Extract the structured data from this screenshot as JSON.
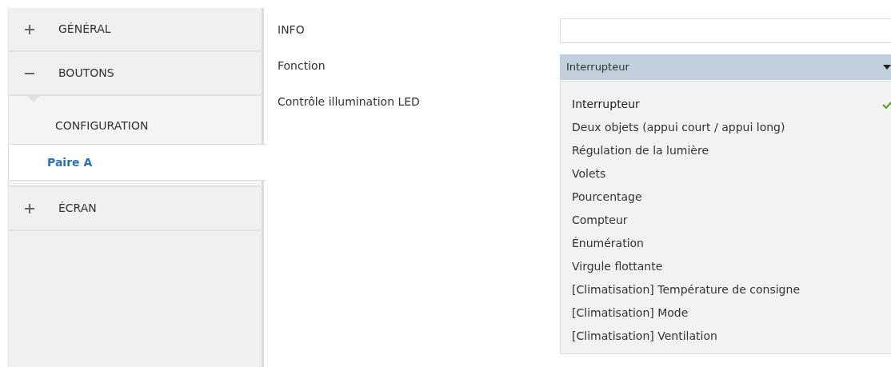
{
  "sidebar": {
    "items": [
      {
        "label": "GÉNÉRAL",
        "expanded": false
      },
      {
        "label": "BOUTONS",
        "expanded": true,
        "children": [
          {
            "label": "CONFIGURATION",
            "selected": false
          },
          {
            "label": "Paire A",
            "selected": true
          }
        ]
      },
      {
        "label": "ÉCRAN",
        "expanded": false
      }
    ]
  },
  "form": {
    "fields": [
      {
        "label": "INFO",
        "kind": "text"
      },
      {
        "label": "Fonction",
        "kind": "dropdown",
        "value": "Interrupteur",
        "expanded": true,
        "options": [
          {
            "label": "Interrupteur",
            "selected": true
          },
          {
            "label": "Deux objets (appui court / appui long)",
            "selected": false
          },
          {
            "label": "Régulation de la lumière",
            "selected": false
          },
          {
            "label": "Volets",
            "selected": false
          },
          {
            "label": "Pourcentage",
            "selected": false
          },
          {
            "label": "Compteur",
            "selected": false
          },
          {
            "label": "Énumération",
            "selected": false
          },
          {
            "label": "Virgule flottante",
            "selected": false
          },
          {
            "label": "[Climatisation] Température de consigne",
            "selected": false
          },
          {
            "label": "[Climatisation] Mode",
            "selected": false
          },
          {
            "label": "[Climatisation] Ventilation",
            "selected": false
          }
        ]
      },
      {
        "label": "Contrôle illumination LED",
        "kind": "label"
      }
    ]
  }
}
